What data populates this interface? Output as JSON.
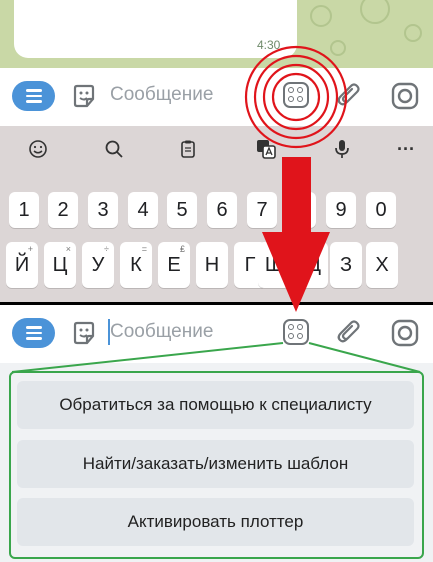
{
  "message": {
    "time": "4:30"
  },
  "input": {
    "placeholder": "Сообщение"
  },
  "keyboard": {
    "number_row": [
      "1",
      "2",
      "3",
      "4",
      "5",
      "6",
      "7",
      "8",
      "9",
      "0"
    ],
    "letter_row": [
      "Й",
      "Ц",
      "У",
      "К",
      "Е",
      "Н",
      "Г",
      "Ш",
      "Щ",
      "З",
      "Х"
    ],
    "letter_hints": [
      "+",
      "×",
      "÷",
      "=",
      "₤",
      "",
      "",
      "",
      "",
      "",
      ""
    ],
    "toolbar": {
      "more": "···"
    }
  },
  "bot_commands": [
    "Обратиться за помощью к специалисту",
    "Найти/заказать/изменить шаблон",
    "Активировать плоттер"
  ],
  "colors": {
    "accent": "#4b93d8",
    "annotation_red": "#e0141b",
    "annotation_green": "#3aa64c",
    "chat_background": "#c9d8a6"
  },
  "icons": [
    "menu-icon",
    "sticker-icon",
    "bot-commands-icon",
    "attach-icon",
    "camera-icon",
    "emoji-icon",
    "search-icon",
    "clipboard-icon",
    "translate-icon",
    "mic-icon",
    "more-icon"
  ]
}
